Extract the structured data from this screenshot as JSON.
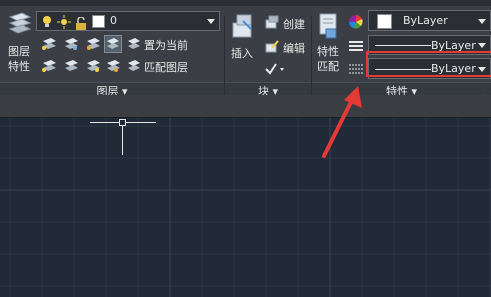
{
  "layers_panel": {
    "layer_properties_label": "图层\n特性",
    "current_layer": "0",
    "set_current_label": "置为当前",
    "match_layer_label": "匹配图层",
    "panel_title": "图层 ▾"
  },
  "block_panel": {
    "insert_label": "插入",
    "create_label": "创建",
    "edit_label": "编辑",
    "panel_title": "块 ▾"
  },
  "properties_panel": {
    "match_properties_label": "特性\n匹配",
    "color_value": "ByLayer",
    "linetype_value": "ByLayer",
    "lineweight_value": "ByLayer",
    "panel_title": "特性 ▾"
  },
  "colors": {
    "ribbon_bg": "#3b3f45",
    "canvas_bg": "#212a37",
    "grid_line": "#2f3b4b",
    "annotation_red": "#e53935"
  }
}
